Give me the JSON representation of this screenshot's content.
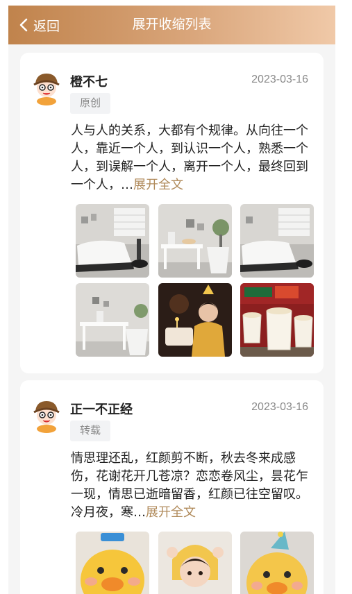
{
  "nav": {
    "back_label": "返回",
    "title": "展开收缩列表"
  },
  "posts": [
    {
      "name": "橙不七",
      "date": "2023-03-16",
      "tag": "原创",
      "text": "人与人的关系，大都有个规律。从向往一个人，靠近一个人，到认识一个人，熟悉一个人，到误解一个人，离开一个人，最终回到一个人，…",
      "expand_label": "展开全文",
      "photos": [
        "bedroom-photo",
        "desk-photo",
        "bedroom-photo",
        "desk-corner-photo",
        "birthday-child-photo",
        "pudding-cups-photo"
      ]
    },
    {
      "name": "正一不正经",
      "date": "2023-03-16",
      "tag": "转载",
      "text": "情思理还乱，红颜剪不断，秋去冬来成感伤，花谢花开几苍凉？恋恋卷风尘，昙花乍一现，情思已逝暗留香，红颜已往空留叹。冷月夜，寒…",
      "expand_label": "展开全文",
      "photos": [
        "duck-toy-photo",
        "child-photo",
        "duck-toy-photo"
      ]
    }
  ]
}
